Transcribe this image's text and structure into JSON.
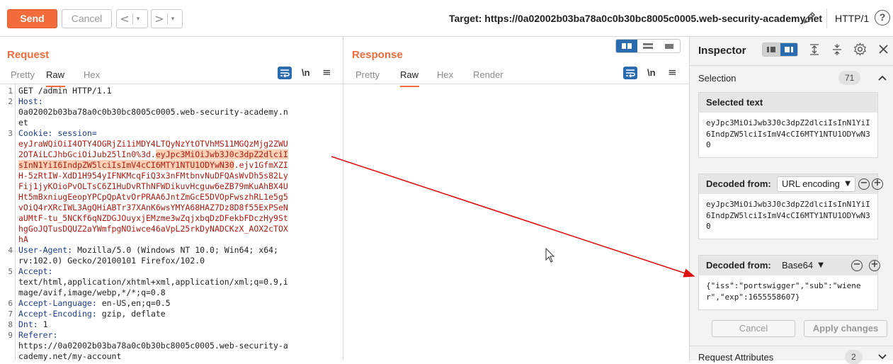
{
  "toolbar": {
    "send_label": "Send",
    "cancel_label": "Cancel",
    "prev_arrow": "<",
    "next_arrow": ">",
    "caret": "▾",
    "target_label": "Target: https://0a02002b03ba78a0c0b30bc8005c0005.web-security-academy.net",
    "protocol": "HTTP/1",
    "help_label": "?"
  },
  "request": {
    "title": "Request",
    "tabs": [
      "Pretty",
      "Raw",
      "Hex"
    ],
    "active_tab": "Raw",
    "newline_toggle": "\\n",
    "menu_icon": "≡",
    "lines": [
      {
        "num": "1",
        "parts": [
          {
            "t": "GET /admin HTTP/1.1",
            "c": ""
          }
        ]
      },
      {
        "num": "2",
        "parts": [
          {
            "t": "Host:",
            "c": "k"
          }
        ]
      },
      {
        "num": "",
        "parts": [
          {
            "t": "0a02002b03ba78a0c0b30bc8005c0005.web-security-academy.n",
            "c": ""
          }
        ]
      },
      {
        "num": "",
        "parts": [
          {
            "t": "et",
            "c": ""
          }
        ]
      },
      {
        "num": "3",
        "parts": [
          {
            "t": "Cookie: session=",
            "c": "k"
          }
        ]
      },
      {
        "num": "",
        "parts": [
          {
            "t": "eyJraWQiOiI4OTY4OGRjZi1iMDY4LTQyNzYtOTVhMS11MGQzMjg2ZWU",
            "c": "r"
          }
        ]
      },
      {
        "num": "",
        "parts": [
          {
            "t": "2OTAiLCJhbGciOiJub25lIn0%3d.",
            "c": "r"
          },
          {
            "t": "eyJpc3MiOiJwb3J0c3dpZ2dlciI",
            "c": "hl"
          }
        ]
      },
      {
        "num": "",
        "parts": [
          {
            "t": "sInN1YiI6IndpZW5lciIsImV4cCI6MTY1NTU1ODYwN30",
            "c": "hl"
          },
          {
            "t": ".ejv1GfmXZI",
            "c": "r"
          }
        ]
      },
      {
        "num": "",
        "parts": [
          {
            "t": "H-5zRtIW-XdD1H954yIFNKMcqFiQ3x3nFMtbnvNuDFQAsWvDh5s82Ly",
            "c": "r"
          }
        ]
      },
      {
        "num": "",
        "parts": [
          {
            "t": "Fij1jyKOioPvOLTsC6Z1HuDvRThNFWDikuvHcguw6eZB79mKuAhBX4U",
            "c": "r"
          }
        ]
      },
      {
        "num": "",
        "parts": [
          {
            "t": "Ht5mBxniugEeopYPCpQpAtvOrPRAA6JntZmGcE5DVOpFwszhRL1e5g5",
            "c": "r"
          }
        ]
      },
      {
        "num": "",
        "parts": [
          {
            "t": "vOiQ4rXRcIWL3AgQHiABTr37XAnK6wsYMYA68HAZ7Dz8D8f55ExPSeN",
            "c": "r"
          }
        ]
      },
      {
        "num": "",
        "parts": [
          {
            "t": "aUMtF-tu_5NCKf6qNZDGJOuyxjEMzme3wZqjxbqDzDFekbFDczHy9St",
            "c": "r"
          }
        ]
      },
      {
        "num": "",
        "parts": [
          {
            "t": "hgGoJQTusDQUZ2aYWmfpgNOiwce46aVpL25rkDyNADCKzX_AOX2cTOX",
            "c": "r"
          }
        ]
      },
      {
        "num": "",
        "parts": [
          {
            "t": "hA",
            "c": "r"
          }
        ]
      },
      {
        "num": "4",
        "parts": [
          {
            "t": "User-Agent:",
            "c": "k"
          },
          {
            "t": " Mozilla/5.0 (Windows NT 10.0; Win64; x64;",
            "c": ""
          }
        ]
      },
      {
        "num": "",
        "parts": [
          {
            "t": "rv:102.0) Gecko/20100101 Firefox/102.0",
            "c": ""
          }
        ]
      },
      {
        "num": "5",
        "parts": [
          {
            "t": "Accept:",
            "c": "k"
          }
        ]
      },
      {
        "num": "",
        "parts": [
          {
            "t": "text/html,application/xhtml+xml,application/xml;q=0.9,i",
            "c": ""
          }
        ]
      },
      {
        "num": "",
        "parts": [
          {
            "t": "mage/avif,image/webp,*/*;q=0.8",
            "c": ""
          }
        ]
      },
      {
        "num": "6",
        "parts": [
          {
            "t": "Accept-Language:",
            "c": "k"
          },
          {
            "t": " en-US,en;q=0.5",
            "c": ""
          }
        ]
      },
      {
        "num": "7",
        "parts": [
          {
            "t": "Accept-Encoding:",
            "c": "k"
          },
          {
            "t": " gzip, deflate",
            "c": ""
          }
        ]
      },
      {
        "num": "8",
        "parts": [
          {
            "t": "Dnt:",
            "c": "k"
          },
          {
            "t": " 1",
            "c": ""
          }
        ]
      },
      {
        "num": "9",
        "parts": [
          {
            "t": "Referer:",
            "c": "k"
          }
        ]
      },
      {
        "num": "",
        "parts": [
          {
            "t": "https://0a02002b03ba78a0c0b30bc8005c0005.web-security-a",
            "c": ""
          }
        ]
      },
      {
        "num": "",
        "parts": [
          {
            "t": "cademy.net/my-account",
            "c": ""
          }
        ]
      }
    ]
  },
  "response": {
    "title": "Response",
    "tabs": [
      "Pretty",
      "Raw",
      "Hex",
      "Render"
    ],
    "active_tab": "Raw",
    "newline_toggle": "\\n",
    "menu_icon": "≡"
  },
  "inspector": {
    "title": "Inspector",
    "selection_label": "Selection",
    "selection_count": "71",
    "selected_text_title": "Selected text",
    "selected_text": "eyJpc3MiOiJwb3J0c3dpZ2dlciIsInN1YiI6IndpZW5lciIsImV4cCI6MTY1NTU1ODYwN30",
    "decoded1_title": "Decoded from:",
    "decoded1_encoding": "URL encoding",
    "decoded1_text": "eyJpc3MiOiJwb3J0c3dpZ2dlciIsInN1YiI6IndpZW5lciIsImV4cCI6MTY1NTU1ODYwN30",
    "decoded2_title": "Decoded from:",
    "decoded2_encoding": "Base64",
    "decoded2_text": "{\"iss\":\"portswigger\",\"sub\":\"wiener\",\"exp\":1655558607}",
    "cancel_label": "Cancel",
    "apply_label": "Apply changes",
    "request_attributes_label": "Request Attributes",
    "request_attributes_count": "2"
  },
  "colors": {
    "accent": "#f26b3a",
    "active_icon": "#2b6cb0",
    "header_key": "#1d3d8f",
    "cookie_value": "#b01a10",
    "highlight": "#fbd0b5",
    "annotation_arrow": "#e01010"
  }
}
